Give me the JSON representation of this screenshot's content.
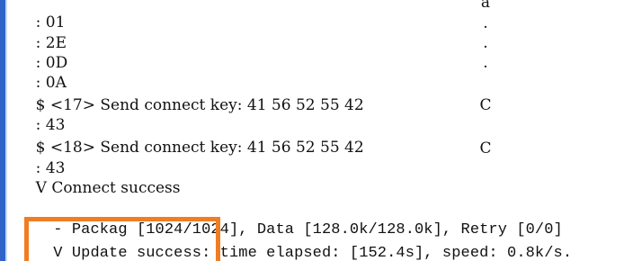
{
  "terminal": {
    "lines": [
      {
        "prefix": ":",
        "text": "01",
        "ascii": "a"
      },
      {
        "prefix": ":",
        "text": "2E",
        "ascii": "."
      },
      {
        "prefix": ":",
        "text": "0D",
        "ascii": "."
      },
      {
        "prefix": ":",
        "text": "0A",
        "ascii": "."
      },
      {
        "prefix": "$",
        "text": "<17> Send connect key: 41 56 52 55 42",
        "ascii": ""
      },
      {
        "prefix": ":",
        "text": "43",
        "ascii": "C"
      },
      {
        "prefix": "$",
        "text": "<18> Send connect key: 41 56 52 55 42",
        "ascii": ""
      },
      {
        "prefix": ":",
        "text": "43",
        "ascii": "C"
      },
      {
        "prefix": "V",
        "text": "Connect success",
        "ascii": ""
      },
      {
        "prefix": "-",
        "text": "Packag [1024/1024], Data [128.0k/128.0k], Retry [0/0]",
        "ascii": ""
      },
      {
        "prefix": "V",
        "text": "Update success: time elapsed: [152.4s], speed: 0.8k/s.",
        "ascii": ""
      }
    ]
  },
  "colors": {
    "accent_bar": "#2f63c8",
    "highlight": "#f07d22",
    "text": "#111111",
    "background": "#ffffff"
  }
}
